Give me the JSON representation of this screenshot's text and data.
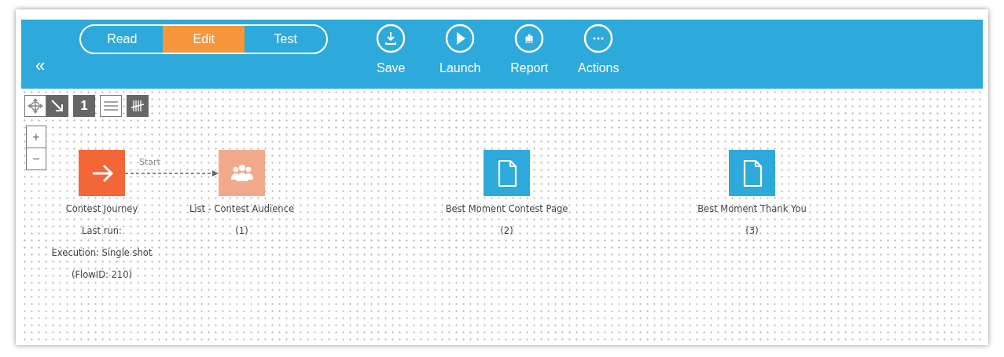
{
  "mode_tabs": [
    {
      "label": "Read",
      "selected": false
    },
    {
      "label": "Edit",
      "selected": true
    },
    {
      "label": "Test",
      "selected": false
    }
  ],
  "collapse": "«",
  "actions": [
    {
      "kind": "save",
      "label": "Save"
    },
    {
      "kind": "launch",
      "label": "Launch"
    },
    {
      "kind": "report",
      "label": "Report"
    },
    {
      "kind": "actions",
      "label": "Actions"
    }
  ],
  "tools": [
    {
      "kind": "move",
      "on": false
    },
    {
      "kind": "connect",
      "on": true
    },
    {
      "kind": "number",
      "label": "1",
      "on": true
    },
    {
      "kind": "lines",
      "on": false
    },
    {
      "kind": "tally",
      "on": true
    }
  ],
  "zoom": [
    "+",
    "−"
  ],
  "nodes": [
    {
      "kind": "start",
      "lines": [
        "Contest Journey",
        "Last run:",
        "Execution: Single shot",
        "(FlowID: 210)"
      ]
    },
    {
      "kind": "list",
      "lines": [
        "List - Contest Audience",
        "(1)"
      ]
    },
    {
      "kind": "page",
      "lines": [
        "Best Moment Contest Page",
        "(2)"
      ]
    },
    {
      "kind": "page",
      "lines": [
        "Best Moment Thank You",
        "(3)"
      ]
    }
  ],
  "edges": [
    {
      "label": "Start"
    }
  ]
}
